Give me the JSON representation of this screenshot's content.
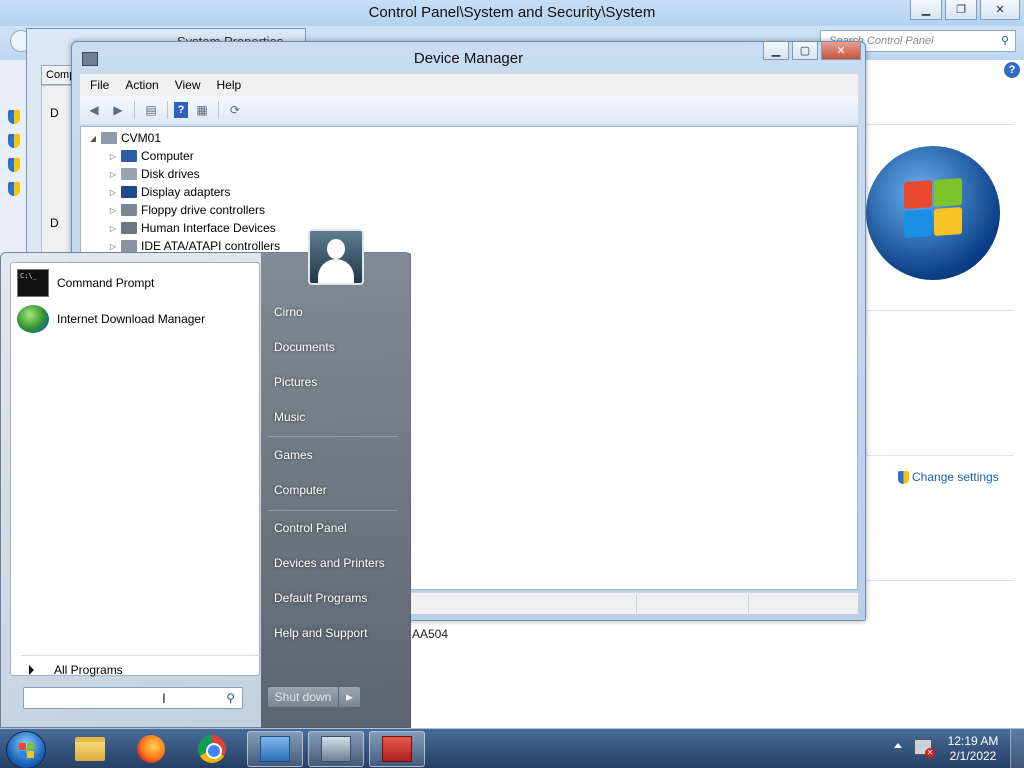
{
  "control_panel": {
    "title": "Control Panel\\System and Security\\System",
    "search_placeholder": "Search Control Panel",
    "change_settings": "Change settings",
    "product_id_fragment": "AA504"
  },
  "system_properties": {
    "title": "System Properties",
    "tab_label": "Comp",
    "label_1": "D",
    "label_2": "D"
  },
  "device_manager": {
    "title": "Device Manager",
    "menu": [
      "File",
      "Action",
      "View",
      "Help"
    ],
    "tree": {
      "root": "CVM01",
      "children": [
        "Computer",
        "Disk drives",
        "Display adapters",
        "Floppy drive controllers",
        "Human Interface Devices",
        "IDE ATA/ATAPI controllers"
      ]
    }
  },
  "start_menu": {
    "pinned": [
      "Command Prompt",
      "Internet Download Manager"
    ],
    "all_programs": "All Programs",
    "right_links": [
      "Cirno",
      "Documents",
      "Pictures",
      "Music",
      "Games",
      "Computer",
      "Control Panel",
      "Devices and Printers",
      "Default Programs",
      "Help and Support"
    ],
    "shutdown_label": "Shut down"
  },
  "taskbar": {
    "apps": [
      "windows-explorer",
      "firefox",
      "chrome",
      "control-panel",
      "device-manager",
      "toolbox"
    ],
    "time": "12:19 AM",
    "date": "2/1/2022"
  }
}
